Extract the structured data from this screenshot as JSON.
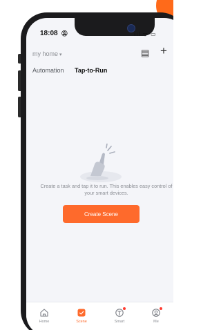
{
  "status_bar": {
    "time": "18:08",
    "icons": "ııl ᯤ ▭"
  },
  "header": {
    "home_name": "my home",
    "caret": "▾",
    "icons": [
      "log-icon",
      "add-icon"
    ],
    "log_glyph": "▤",
    "add_glyph": "+"
  },
  "tabs": [
    {
      "label": "Automation",
      "active": false
    },
    {
      "label": "Tap-to-Run",
      "active": true
    }
  ],
  "empty_state": {
    "message": "Create a task and tap it to run. This enables easy control of your smart devices.",
    "button_label": "Create Scene"
  },
  "bottom_nav": [
    {
      "label": "Home",
      "icon": "home-icon",
      "active": false
    },
    {
      "label": "Scene",
      "icon": "scene-icon",
      "active": true
    },
    {
      "label": "Smart",
      "icon": "smart-icon",
      "active": false,
      "dot": true
    },
    {
      "label": "Me",
      "icon": "me-icon",
      "active": false,
      "dot": true
    }
  ],
  "colors": {
    "accent": "#fe6a2c",
    "badge": "#ff6a1a",
    "screen_bg": "#f4f5f9",
    "frame": "#1b1b1d"
  }
}
